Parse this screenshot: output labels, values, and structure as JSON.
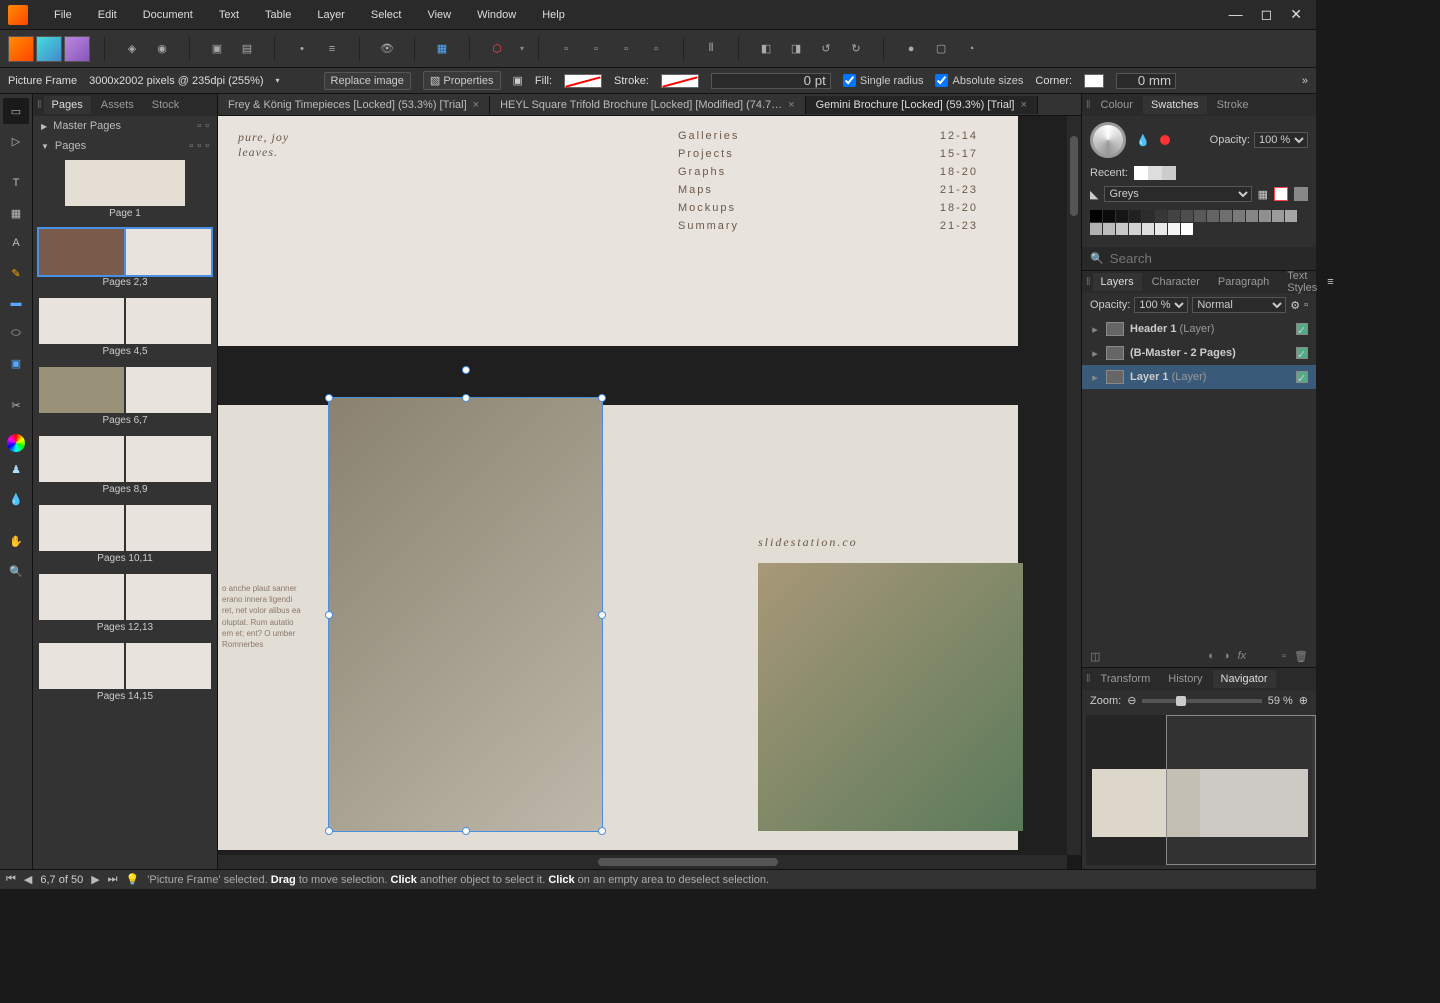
{
  "menu": {
    "items": [
      "File",
      "Edit",
      "Document",
      "Text",
      "Table",
      "Layer",
      "Select",
      "View",
      "Window",
      "Help"
    ]
  },
  "contextbar": {
    "tool": "Picture Frame",
    "dims": "3000x2002 pixels @ 235dpi (255%)",
    "replace": "Replace image",
    "properties": "Properties",
    "fill": "Fill:",
    "stroke": "Stroke:",
    "stroke_val": "0 pt",
    "single_radius": "Single radius",
    "absolute": "Absolute sizes",
    "corner": "Corner:",
    "corner_val": "0 mm"
  },
  "doc_tabs": [
    {
      "label": "Frey & König Timepieces [Locked] (53.3%) [Trial]"
    },
    {
      "label": "HEYL Square Trifold Brochure [Locked] [Modified] (74.7…"
    },
    {
      "label": "Gemini Brochure [Locked] (59.3%) [Trial]",
      "active": true
    }
  ],
  "pages_panel": {
    "tabs": [
      "Pages",
      "Assets",
      "Stock"
    ],
    "master": "Master Pages",
    "pages": "Pages",
    "thumbs": [
      {
        "label": "Page 1",
        "single": true
      },
      {
        "label": "Pages 2,3",
        "selected": true,
        "brown": true
      },
      {
        "label": "Pages 4,5"
      },
      {
        "label": "Pages 6,7",
        "olive": true
      },
      {
        "label": "Pages 8,9"
      },
      {
        "label": "Pages 10,11"
      },
      {
        "label": "Pages 12,13"
      },
      {
        "label": "Pages 14,15"
      }
    ]
  },
  "canvas": {
    "italic1": "pure, joy",
    "italic2": "leaves.",
    "toc": [
      {
        "t": "Galleries",
        "p": "12-14"
      },
      {
        "t": "Projects",
        "p": "15-17"
      },
      {
        "t": "Graphs",
        "p": "18-20"
      },
      {
        "t": "Maps",
        "p": "21-23"
      },
      {
        "t": "Mockups",
        "p": "18-20"
      },
      {
        "t": "Summary",
        "p": "21-23"
      }
    ],
    "watermark": "slidestation.co",
    "body_text": "o anche plaut sanner erano innera ligendi ret, net volor alibus ea oluptat. Rum autatio em et; ent? O umber Romnerbes"
  },
  "right": {
    "color_tabs": [
      "Colour",
      "Swatches",
      "Stroke"
    ],
    "opacity_lbl": "Opacity:",
    "opacity_val": "100 %",
    "recent": "Recent:",
    "palette": "Greys",
    "search_ph": "Search",
    "layer_tabs": [
      "Layers",
      "Character",
      "Paragraph",
      "Text Styles"
    ],
    "layers_opacity": "Opacity:",
    "layer_opacity_val": "100 %",
    "blend": "Normal",
    "layers": [
      {
        "name": "Header 1",
        "suffix": "(Layer)"
      },
      {
        "name": "(B-Master - 2 Pages)",
        "suffix": ""
      },
      {
        "name": "Layer 1",
        "suffix": "(Layer)",
        "selected": true
      }
    ],
    "nav_tabs": [
      "Transform",
      "History",
      "Navigator"
    ],
    "zoom_lbl": "Zoom:",
    "zoom_val": "59 %"
  },
  "status": {
    "pages": "6,7 of 50",
    "hint_pre": "'Picture Frame' selected. ",
    "drag": "Drag",
    "drag_txt": " to move selection. ",
    "click": "Click",
    "click_txt": " another object to select it. ",
    "click2": "Click",
    "click2_txt": " on an empty area to deselect selection."
  }
}
